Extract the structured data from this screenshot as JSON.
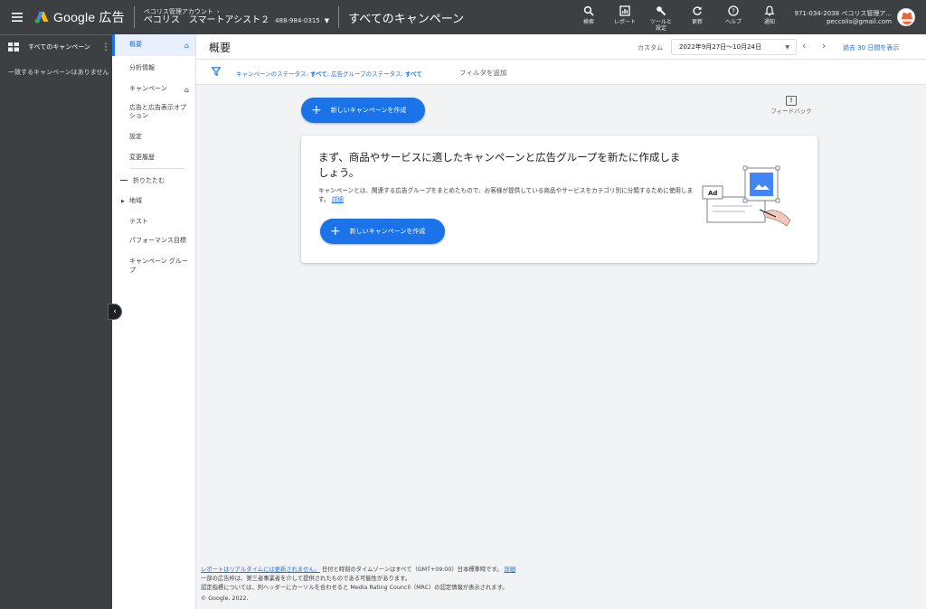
{
  "topbar": {
    "product": "Google 広告",
    "account_parent": "ペコリス管理アカウント",
    "account_name": "ペコリス　スマートアシスト２",
    "account_id": "488-984-0315",
    "page_title": "すべてのキャンペーン",
    "actions": [
      {
        "icon": "search-icon",
        "label": "検索"
      },
      {
        "icon": "reports-icon",
        "label": "レポート"
      },
      {
        "icon": "tools-icon",
        "label": "ツールと\n設定"
      },
      {
        "icon": "refresh-icon",
        "label": "更新"
      },
      {
        "icon": "help-icon",
        "label": "ヘルプ"
      },
      {
        "icon": "bell-icon",
        "label": "通知"
      }
    ],
    "user_line1": "971-034-2038 ペコリス管理ア...",
    "user_email": "peccolis@gmail.com"
  },
  "left_panel": {
    "title": "すべてのキャンペーン",
    "empty_message": "一致するキャンペーンはありません"
  },
  "nav": {
    "overview": "概要",
    "insights": "分析情報",
    "campaigns": "キャンペーン",
    "ads_extensions": "広告と広告表示オプション",
    "settings": "設定",
    "change_history": "変更履歴",
    "collapse": "折りたたむ",
    "locations": "地域",
    "experiments": "テスト",
    "performance_targets": "パフォーマンス目標",
    "campaign_groups": "キャンペーン グループ"
  },
  "header": {
    "title": "概要",
    "custom_label": "カスタム",
    "date_range": "2022年9月27日～10月24日",
    "last_30": "過去 30 日間を表示"
  },
  "filter": {
    "campaign_status_label": "キャンペーンのステータス:",
    "campaign_status_value": "すべて",
    "adgroup_status_label": "広告グループのステータス:",
    "adgroup_status_value": "すべて",
    "add_filter": "フィルタを追加"
  },
  "main": {
    "new_campaign_button": "新しいキャンペーンを作成",
    "feedback": "フィードバック",
    "card_title": "まず、商品やサービスに適したキャンペーンと広告グループを新たに作成しましょう。",
    "card_desc": "キャンペーンとは、関連する広告グループをまとめたもので、お客様が提供している商品やサービスをカテゴリ別に分類するために使用します。",
    "card_link": "詳細",
    "card_button": "新しいキャンペーンを作成",
    "illus_ad_label": "Ad"
  },
  "footer": {
    "line1_link": "レポートはリアルタイムには更新されません。",
    "line1_text": "日付と時刻のタイムゾーンはすべて（GMT+09:00）日本標準時です。",
    "line1_link2": "詳細",
    "line2": "一部の広告枠は、第三者事業者を介して提供されたものである可能性があります。",
    "line3": "認定指標については、列ヘッダーにカーソルを合わせると Media Rating Council（MRC）の認定情報が表示されます。",
    "copyright": "© Google, 2022."
  },
  "colors": {
    "topbar_bg": "#3c4043",
    "accent": "#1a73e8",
    "page_bg": "#f1f3f4"
  }
}
